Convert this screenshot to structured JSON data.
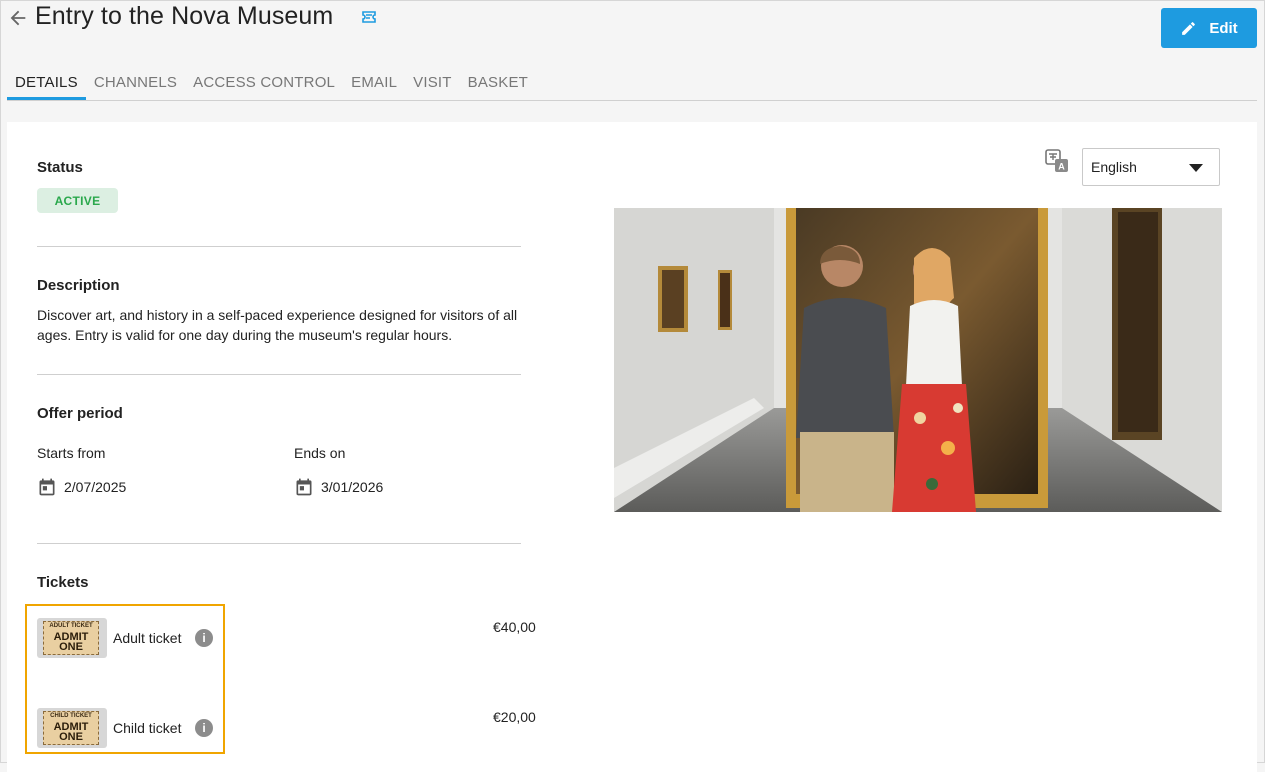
{
  "header": {
    "title": "Entry to the Nova Museum",
    "edit_label": "Edit"
  },
  "tabs": [
    {
      "label": "DETAILS",
      "active": true
    },
    {
      "label": "CHANNELS",
      "active": false
    },
    {
      "label": "ACCESS CONTROL",
      "active": false
    },
    {
      "label": "EMAIL",
      "active": false
    },
    {
      "label": "VISIT",
      "active": false
    },
    {
      "label": "BASKET",
      "active": false
    }
  ],
  "status": {
    "label": "Status",
    "value": "ACTIVE"
  },
  "description": {
    "label": "Description",
    "text": "Discover art, and history in a self-paced experience designed for visitors of all ages. Entry is valid for one day during the museum's regular hours."
  },
  "offer_period": {
    "label": "Offer period",
    "starts_label": "Starts from",
    "starts_value": "2/07/2025",
    "ends_label": "Ends on",
    "ends_value": "3/01/2026"
  },
  "tickets": {
    "label": "Tickets",
    "items": [
      {
        "name": "Adult ticket",
        "price": "€40,00",
        "thumb_label": "ADULT TICKET",
        "thumb_admit": "ADMIT",
        "thumb_one": "ONE"
      },
      {
        "name": "Child ticket",
        "price": "€20,00",
        "thumb_label": "CHILD TICKET",
        "thumb_admit": "ADMIT",
        "thumb_one": "ONE"
      }
    ]
  },
  "language": {
    "selected": "English"
  },
  "colors": {
    "accent": "#1e9be0",
    "status_bg": "#dcefe2",
    "status_text": "#2aa84c",
    "highlight": "#f0a500"
  },
  "icons": [
    "back-arrow-icon",
    "ticket-type-icon",
    "pencil-icon",
    "calendar-icon",
    "info-icon",
    "translate-icon",
    "caret-down-icon"
  ]
}
